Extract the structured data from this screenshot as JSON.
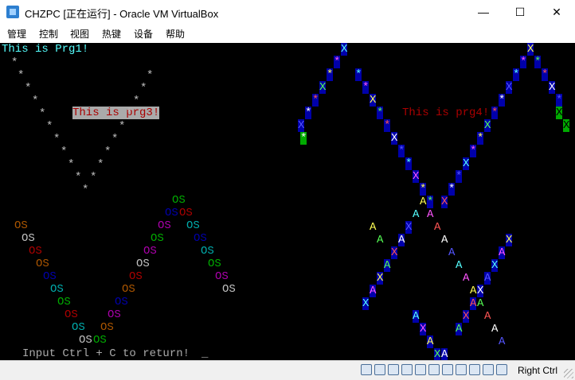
{
  "window": {
    "title": "CHZPC [正在运行] - Oracle VM VirtualBox",
    "controls": {
      "minimize": "—",
      "maximize": "☐",
      "close": "✕"
    }
  },
  "menu": [
    "管理",
    "控制",
    "视图",
    "热键",
    "设备",
    "帮助"
  ],
  "console": {
    "background": "#000000",
    "labels": {
      "prg1": "This is Prg1!",
      "prg3": "This is prg3!",
      "prg4": "This is prg4!"
    },
    "prompt": "Input Ctrl + C to return!",
    "cursor": "_",
    "glyphs": {
      "star": "*",
      "os": "OS",
      "x": "X",
      "a": "A"
    }
  },
  "statusbar": {
    "host_key": "Right Ctrl",
    "icons": [
      "hard-disk-icon",
      "optical-drive-icon",
      "audio-icon",
      "network-icon",
      "usb-icon",
      "shared-folder-icon",
      "display-icon",
      "video-capture-icon",
      "cpu-icon",
      "mouse-integration-icon",
      "keyboard-icon"
    ]
  }
}
